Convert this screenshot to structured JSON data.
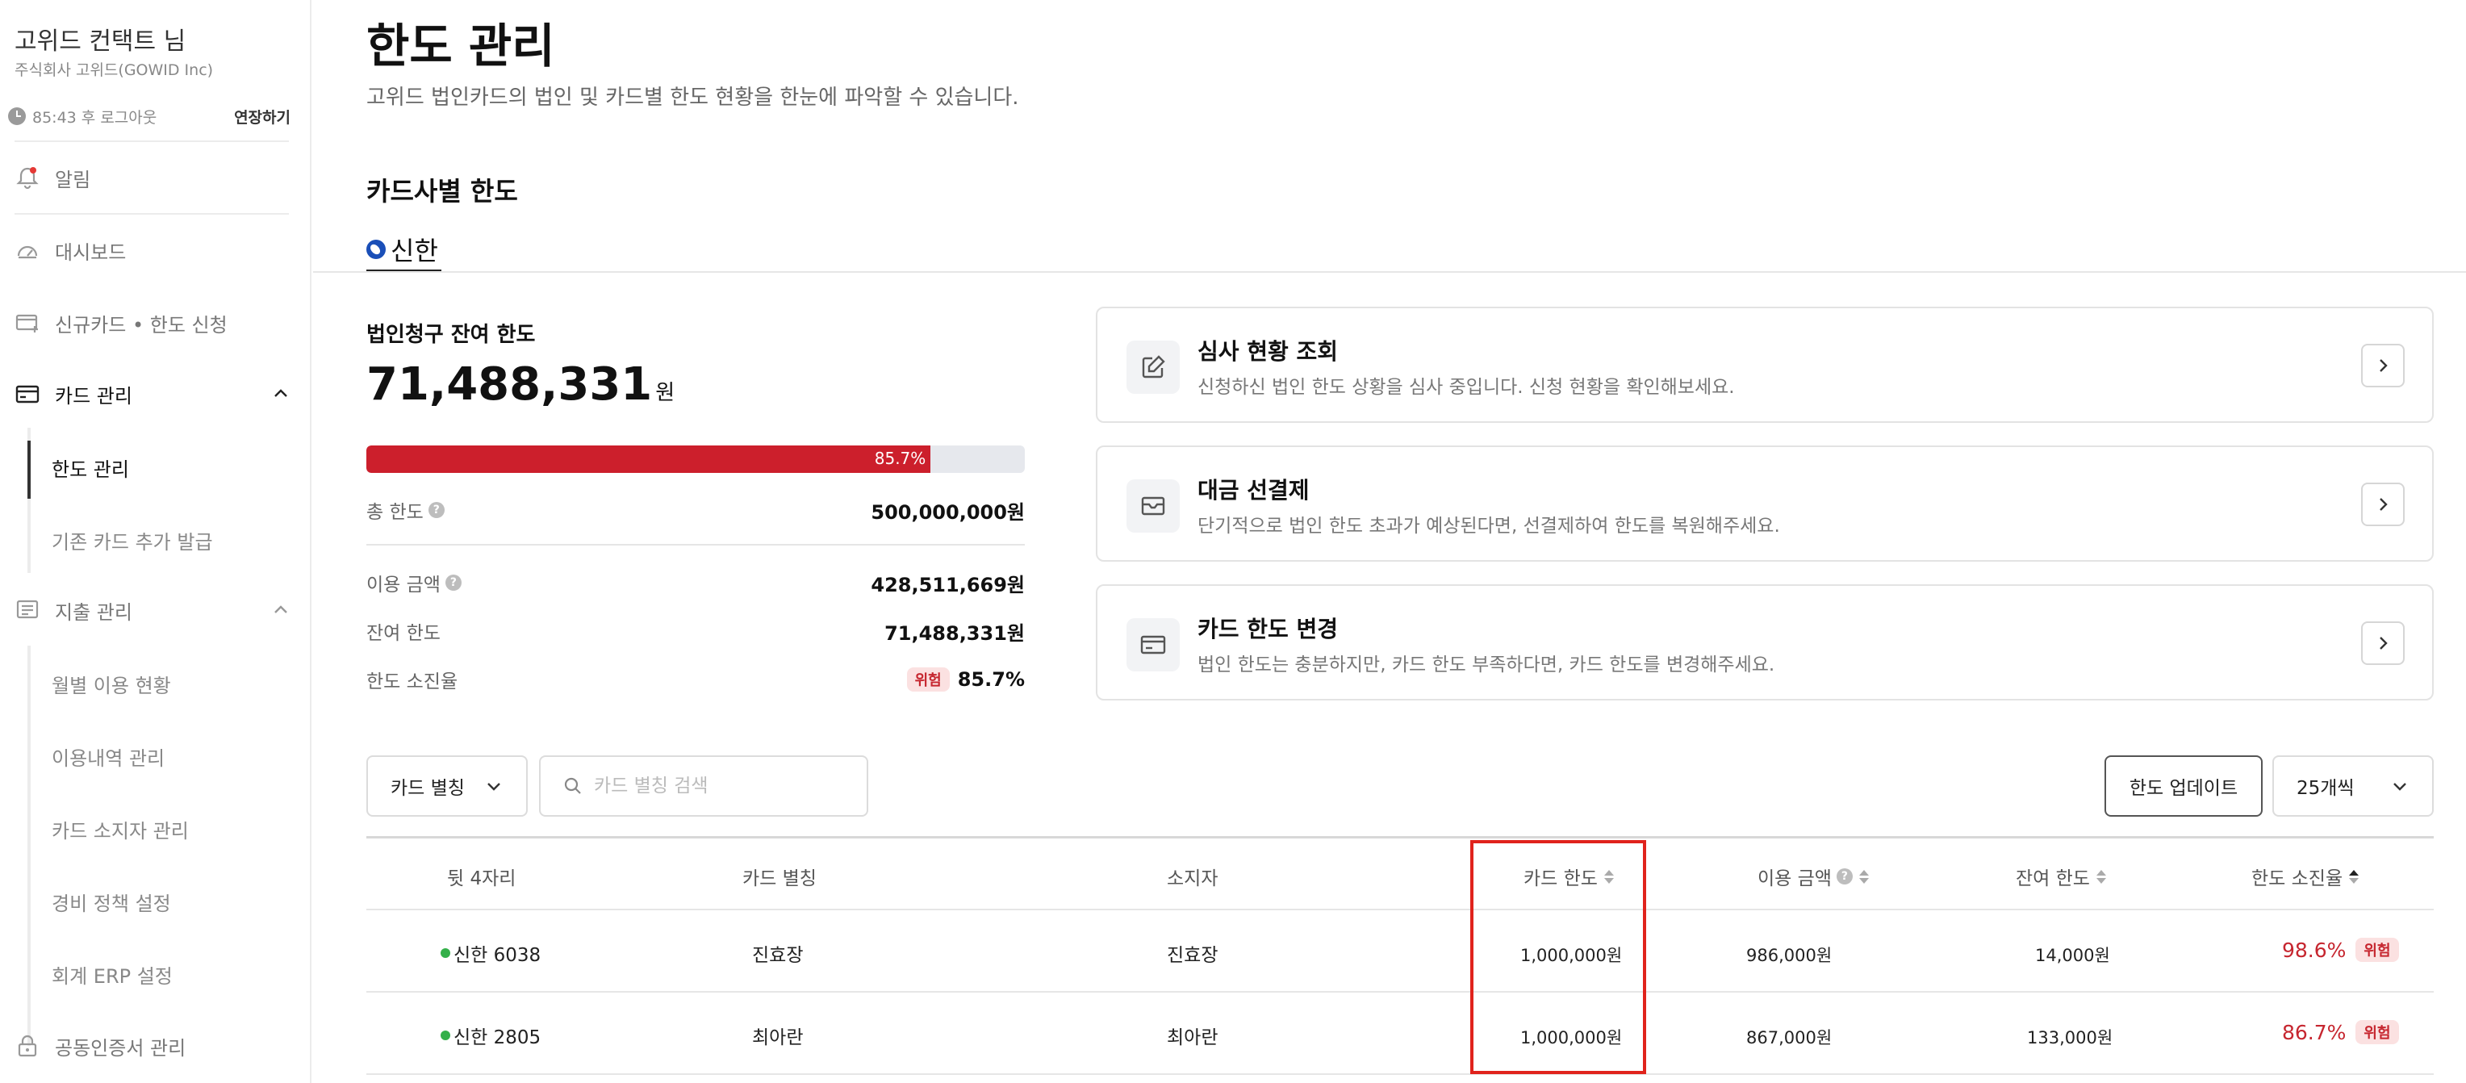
{
  "sidebar": {
    "user_name": "고위드 컨택트 님",
    "company": "주식회사 고위드(GOWID Inc)",
    "session_text": "85:43 후 로그아웃",
    "extend_label": "연장하기",
    "items": {
      "notifications": "알림",
      "dashboard": "대시보드",
      "new_card": "신규카드 • 한도 신청",
      "card_mgmt": "카드 관리",
      "expense_mgmt": "지출 관리",
      "certificate": "공동인증서 관리"
    },
    "card_sub": {
      "limit_mgmt": "한도 관리",
      "additional_issue": "기존 카드 추가 발급"
    },
    "expense_sub": {
      "monthly": "월별 이용 현황",
      "history": "이용내역 관리",
      "holders": "카드 소지자 관리",
      "policy": "경비 정책 설정",
      "erp": "회계 ERP 설정"
    }
  },
  "header": {
    "title": "한도 관리",
    "description": "고위드 법인카드의 법인 및 카드별 한도 현황을 한눈에 파악할 수 있습니다."
  },
  "section_title": "카드사별 한도",
  "bank_tab": "신한",
  "summary": {
    "title": "법인청구 잔여 한도",
    "amount": "71,488,331",
    "won": "원",
    "progress_label": "85.7%",
    "progress_value": 85.7,
    "total_label": "총 한도",
    "total_value": "500,000,000원",
    "used_label": "이용 금액",
    "used_value": "428,511,669원",
    "remaining_label": "잔여 한도",
    "remaining_value": "71,488,331원",
    "rate_label": "한도 소진율",
    "rate_badge": "위험",
    "rate_value": "85.7%"
  },
  "actions": [
    {
      "title": "심사 현황 조회",
      "desc": "신청하신 법인 한도 상황을 심사 중입니다. 신청 현황을 확인해보세요."
    },
    {
      "title": "대금 선결제",
      "desc": "단기적으로 법인 한도 초과가 예상된다면, 선결제하여 한도를 복원해주세요."
    },
    {
      "title": "카드 한도 변경",
      "desc": "법인 한도는 충분하지만, 카드 한도 부족하다면, 카드 한도를 변경해주세요."
    }
  ],
  "filters": {
    "select_label": "카드 별칭",
    "search_placeholder": "카드 별칭 검색",
    "update_label": "한도 업데이트",
    "page_size_label": "25개씩"
  },
  "table": {
    "columns": [
      "뒷 4자리",
      "카드 별칭",
      "소지자",
      "카드 한도",
      "이용 금액",
      "잔여 한도",
      "한도 소진율"
    ],
    "rows": [
      {
        "card": "신한 6038",
        "alias": "진효장",
        "holder": "진효장",
        "limit": "1,000,000원",
        "used": "986,000원",
        "remaining": "14,000원",
        "rate": "98.6%",
        "badge": "위험"
      },
      {
        "card": "신한 2805",
        "alias": "최아란",
        "holder": "최아란",
        "limit": "1,000,000원",
        "used": "867,000원",
        "remaining": "133,000원",
        "rate": "86.7%",
        "badge": "위험"
      }
    ]
  },
  "colors": {
    "danger": "#cc1f2c",
    "active_dot": "#34b04a",
    "highlight": "#e0231c"
  }
}
